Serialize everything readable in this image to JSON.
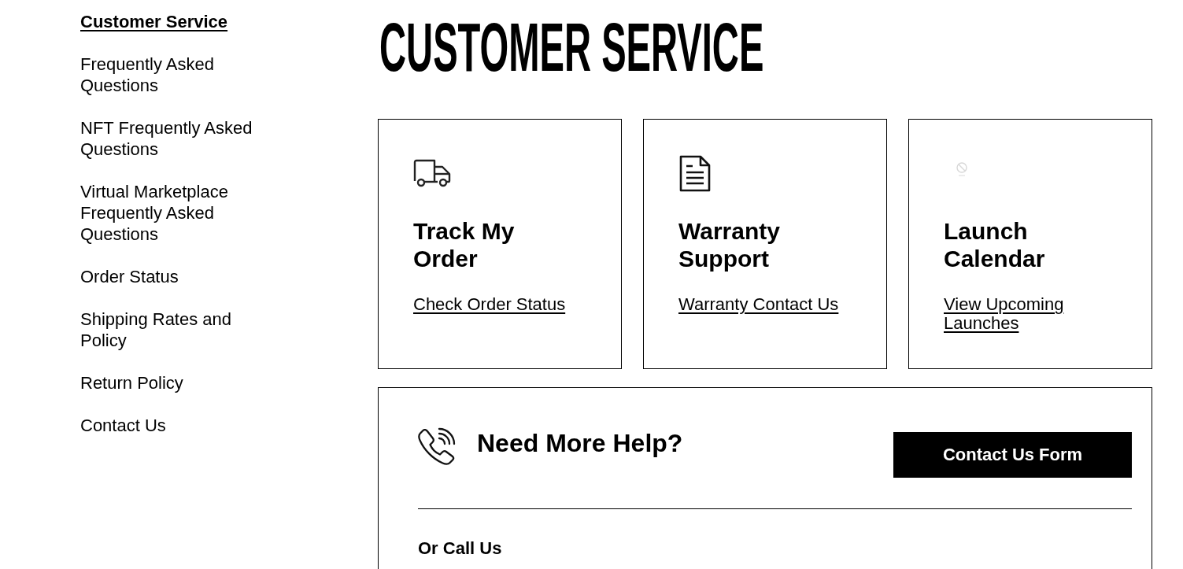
{
  "sidebar": {
    "items": [
      {
        "label": "Customer Service",
        "selected": true
      },
      {
        "label": "Frequently Asked Questions",
        "selected": false
      },
      {
        "label": "NFT Frequently Asked Questions",
        "selected": false
      },
      {
        "label": "Virtual Marketplace Frequently Asked Questions",
        "selected": false
      },
      {
        "label": "Order Status",
        "selected": false
      },
      {
        "label": "Shipping Rates and Policy",
        "selected": false
      },
      {
        "label": "Return Policy",
        "selected": false
      },
      {
        "label": "Contact Us",
        "selected": false
      }
    ]
  },
  "page_title": "CUSTOMER SERVICE",
  "cards": [
    {
      "kind": "truck",
      "title": "Track My Order",
      "link": "Check Order Status"
    },
    {
      "kind": "document",
      "title": "Warranty Support",
      "link": "Warranty Contact Us"
    },
    {
      "kind": "missing-image",
      "title": "Launch Calendar",
      "link": "View Upcoming Launches"
    }
  ],
  "help": {
    "heading": "Need More Help?",
    "button": "Contact Us Form",
    "call_heading": "Or Call Us"
  }
}
